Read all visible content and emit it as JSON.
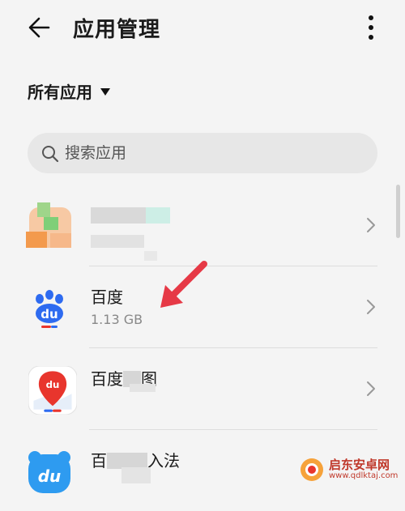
{
  "header": {
    "title": "应用管理"
  },
  "filter": {
    "label": "所有应用"
  },
  "search": {
    "placeholder": "搜索应用"
  },
  "apps": [
    {
      "name": "",
      "size": ""
    },
    {
      "name": "百度",
      "size": "1.13 GB"
    },
    {
      "name": "百度",
      "name_suffix": "图",
      "size": ""
    },
    {
      "name": "百",
      "name_suffix": "入法",
      "size": ""
    }
  ],
  "watermark": {
    "title": "启东安卓网",
    "url": "www.qdlktaj.com"
  },
  "icons": {
    "back": "arrow-left-icon",
    "more": "more-vertical-icon",
    "caret": "caret-down-icon",
    "search": "search-icon",
    "chevron": "chevron-right-icon",
    "annotation": "red-arrow-icon"
  },
  "colors": {
    "accent": "#e63946",
    "baidu_blue": "#2e6bf0",
    "map_red": "#e8352d"
  }
}
